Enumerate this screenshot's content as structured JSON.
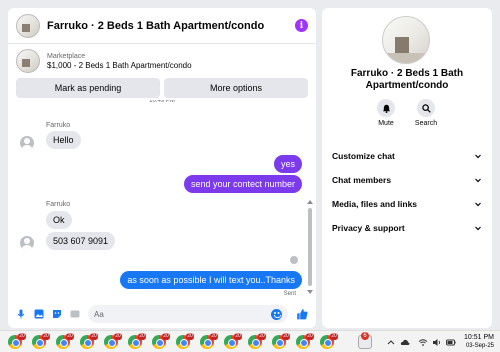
{
  "chat": {
    "title": "Farruko · 2 Beds 1 Bath Apartment/condo",
    "listing_label": "Marketplace",
    "listing_price": "$1,000 - 2 Beds 1 Bath Apartment/condo",
    "mark_pending": "Mark as pending",
    "more_options": "More options",
    "time_stub": "10:49 PM",
    "messages": [
      {
        "from": "Farruko",
        "text": "Hello",
        "sender_label": "Farruko"
      },
      {
        "from": "me",
        "text": "yes"
      },
      {
        "from": "me",
        "text": "send your contect number"
      },
      {
        "from": "Farruko",
        "text": "Ok",
        "sender_label": "Farruko"
      },
      {
        "from": "Farruko",
        "text": "503 607 9091"
      },
      {
        "from": "me",
        "text": "as soon as possible I will text you..Thanks"
      }
    ],
    "sent_status": "Sent",
    "composer_placeholder": "Aa"
  },
  "side": {
    "title": "Farruko · 2 Beds 1 Bath Apartment/condo",
    "actions": [
      {
        "label": "Mute",
        "icon": "bell-icon"
      },
      {
        "label": "Search",
        "icon": "search-icon"
      }
    ],
    "menu": [
      "Customize chat",
      "Chat members",
      "Media, files and links",
      "Privacy & support"
    ]
  },
  "taskbar": {
    "badges": [
      "20",
      "20",
      "20",
      "20",
      "20",
      "20",
      "20",
      "20",
      "20",
      "20",
      "20",
      "20",
      "20",
      "20"
    ],
    "tray_badge": "6",
    "time": "10:51 PM",
    "date": "03-Sep-25"
  },
  "colors": {
    "accent_purple": "#7c3aed",
    "accent_blue": "#1877f2",
    "bubble_gray": "#e4e6eb"
  }
}
